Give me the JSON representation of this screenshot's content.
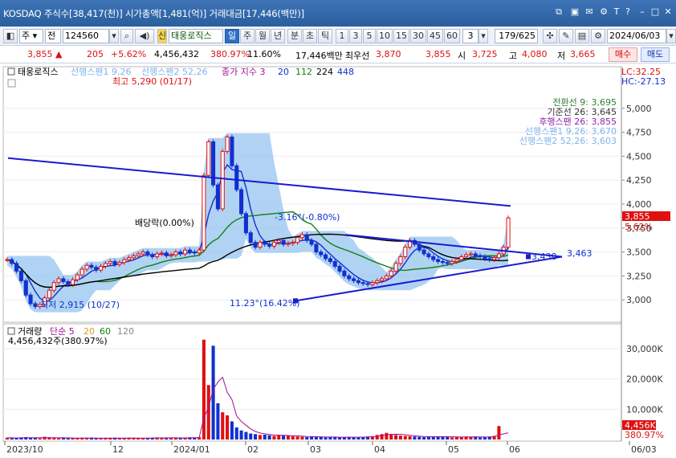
{
  "window": {
    "title": "KOSDAQ 주식수[38,417(천)] 시가총액[1,481(억)] 거래대금[17,446(백만)]"
  },
  "toolbar": {
    "market": "주",
    "type": "전",
    "code": "124560",
    "name": "태웅로직스",
    "periods": [
      "일",
      "주",
      "월",
      "년",
      "분",
      "초",
      "틱"
    ],
    "selected_period": "일",
    "intervals": [
      "1",
      "3",
      "5",
      "10",
      "15",
      "30",
      "45",
      "60"
    ],
    "interval_value": "3",
    "page": "179/625",
    "date": "2024/06/03"
  },
  "quote": {
    "price": "3,855",
    "change": "205",
    "change_pct": "+5.62%",
    "volume": "4,456,432",
    "volume_ratio": "380.97%",
    "turnover": "11.60%",
    "amount": "17,446백만",
    "best_ask_label": "최우선",
    "best_ask": "3,870",
    "best_bid": "3,855",
    "open_label": "시",
    "open": "3,725",
    "high_label": "고",
    "high": "4,080",
    "low_label": "저",
    "low": "3,665",
    "buy_label": "매수",
    "sell_label": "매도"
  },
  "chart_data": [
    {
      "type": "candlestick",
      "title": "태웅로직스",
      "legend": [
        "선행스팬1 9,26",
        "선행스팬2 52,26",
        "종가 지수 3",
        "20",
        "112",
        "224",
        "448"
      ],
      "lc": "LC:32.25",
      "hc": "HC:-27.13",
      "ylim": [
        2800,
        5300
      ],
      "yticks": [
        "5,000",
        "4,750",
        "4,500",
        "4,250",
        "4,000",
        "3,750",
        "3,500",
        "3,250",
        "3,000"
      ],
      "xticks": [
        "2023/10",
        "12",
        "2024/01",
        "02",
        "03",
        "04",
        "05",
        "06",
        "06/03"
      ],
      "ichimoku": [
        {
          "label": "전환선 9",
          "value": "3,695",
          "color": "#2e7d32"
        },
        {
          "label": "기준선 26",
          "value": "3,645",
          "color": "#333333"
        },
        {
          "label": "후행스팬 26",
          "value": "3,855",
          "color": "#8e24aa"
        },
        {
          "label": "선행스팬1 9,26",
          "value": "3,670",
          "color": "#7fb3ea"
        },
        {
          "label": "선행스팬2 52,26",
          "value": "3,603",
          "color": "#7fb3ea"
        }
      ],
      "price_tag": "3,855",
      "price_tag_pct": "5.62%",
      "annotations": {
        "high": "최고 5,290 (01/17)",
        "low": "최저 2,915 (10/27)",
        "ex_dividend": "배당락(0.00%)",
        "trend_down": "-3.16°(-0.80%)",
        "trend_up": "11.23°(16.42%)",
        "level_a": "3,438",
        "level_b": "3,463"
      },
      "close_series": [
        3420,
        3380,
        3300,
        3200,
        3050,
        2960,
        2930,
        2950,
        3020,
        3100,
        3180,
        3220,
        3190,
        3160,
        3210,
        3260,
        3320,
        3360,
        3340,
        3310,
        3350,
        3380,
        3400,
        3370,
        3390,
        3420,
        3440,
        3460,
        3480,
        3500,
        3470,
        3450,
        3480,
        3490,
        3460,
        3470,
        3500,
        3480,
        3520,
        3500,
        3490,
        3520,
        4300,
        4650,
        4200,
        3950,
        4550,
        4700,
        4400,
        4150,
        3900,
        3700,
        3600,
        3550,
        3600,
        3580,
        3560,
        3600,
        3620,
        3580,
        3590,
        3600,
        3650,
        3680,
        3620,
        3580,
        3500,
        3470,
        3430,
        3400,
        3350,
        3300,
        3250,
        3220,
        3200,
        3180,
        3170,
        3160,
        3180,
        3200,
        3220,
        3250,
        3300,
        3380,
        3450,
        3550,
        3620,
        3580,
        3520,
        3480,
        3450,
        3420,
        3400,
        3390,
        3380,
        3400,
        3420,
        3450,
        3470,
        3480,
        3460,
        3450,
        3430,
        3420,
        3440,
        3480,
        3550,
        3855
      ]
    },
    {
      "type": "bar",
      "title": "거래량",
      "legend": [
        "단순 5",
        "20",
        "60",
        "120"
      ],
      "value_label": "4,456,432주(380.97%)",
      "yticks": [
        "30,000K",
        "20,000K",
        "10,000K"
      ],
      "ylim": [
        0,
        34000
      ],
      "tag": "4,456K",
      "tag_pct": "380.97%",
      "values_k": [
        600,
        500,
        400,
        700,
        800,
        600,
        500,
        400,
        900,
        700,
        500,
        400,
        500,
        600,
        500,
        400,
        450,
        500,
        600,
        400,
        350,
        400,
        500,
        600,
        450,
        400,
        500,
        550,
        450,
        400,
        500,
        600,
        700,
        500,
        450,
        600,
        550,
        500,
        600,
        700,
        650,
        800,
        33000,
        18000,
        31000,
        12000,
        9000,
        8000,
        6000,
        4000,
        3000,
        2500,
        2000,
        1800,
        1500,
        1600,
        1400,
        1200,
        1500,
        1300,
        1200,
        1100,
        1000,
        900,
        800,
        1000,
        900,
        800,
        700,
        800,
        900,
        700,
        800,
        750,
        700,
        800,
        900,
        1000,
        1100,
        1500,
        1800,
        2200,
        1800,
        1500,
        1300,
        1200,
        1100,
        1000,
        900,
        800,
        900,
        1000,
        1100,
        900,
        800,
        700,
        800,
        900,
        1000,
        900,
        800,
        700,
        800,
        1000,
        1200,
        4456
      ]
    }
  ]
}
